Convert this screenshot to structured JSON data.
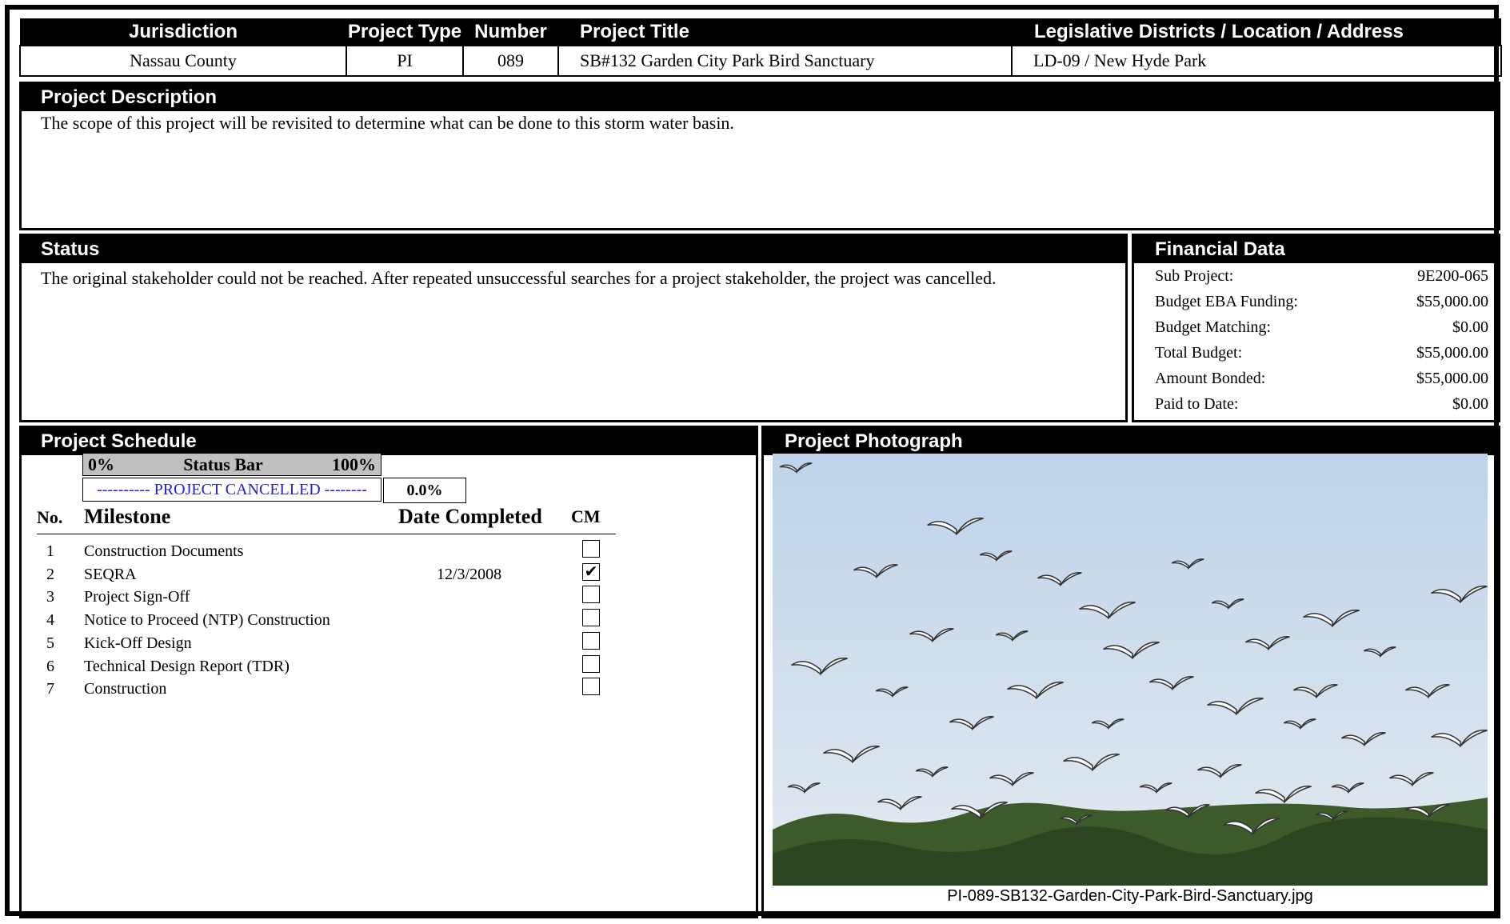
{
  "header": {
    "columns": [
      "Jurisdiction",
      "Project Type",
      "Number",
      "Project Title",
      "Legislative Districts / Location / Address"
    ],
    "values": [
      "Nassau County",
      "PI",
      "089",
      "SB#132 Garden City Park Bird Sanctuary",
      "LD-09 / New Hyde Park"
    ]
  },
  "description": {
    "heading": "Project Description",
    "text": "The scope of this project will be revisited to determine what can be done to this storm water basin."
  },
  "status": {
    "heading": "Status",
    "text": "The original stakeholder could not be reached. After repeated unsuccessful searches for a project stakeholder, the project was cancelled."
  },
  "financial": {
    "heading": "Financial Data",
    "rows": [
      {
        "label": "Sub Project:",
        "value": "9E200-065"
      },
      {
        "label": "Budget EBA Funding:",
        "value": "$55,000.00"
      },
      {
        "label": "Budget Matching:",
        "value": "$0.00"
      },
      {
        "label": "Total Budget:",
        "value": "$55,000.00"
      },
      {
        "label": "Amount Bonded:",
        "value": "$55,000.00"
      },
      {
        "label": "Paid to Date:",
        "value": "$0.00"
      }
    ]
  },
  "schedule": {
    "heading": "Project Schedule",
    "statusbar": {
      "left": "0%",
      "center": "Status Bar",
      "right": "100%",
      "progress_label": "---------- PROJECT CANCELLED --------",
      "percent": "0.0%",
      "progress_fraction": 0.0
    },
    "columns": {
      "no": "No.",
      "milestone": "Milestone",
      "date": "Date Completed",
      "cm": "CM"
    },
    "milestones": [
      {
        "no": "1",
        "name": "Construction Documents",
        "date": "",
        "checked": false
      },
      {
        "no": "2",
        "name": "SEQRA",
        "date": "12/3/2008",
        "checked": true
      },
      {
        "no": "3",
        "name": "Project Sign-Off",
        "date": "",
        "checked": false
      },
      {
        "no": "4",
        "name": "Notice to Proceed (NTP) Construction",
        "date": "",
        "checked": false
      },
      {
        "no": "5",
        "name": "Kick-Off Design",
        "date": "",
        "checked": false
      },
      {
        "no": "6",
        "name": "Technical Design Report (TDR)",
        "date": "",
        "checked": false
      },
      {
        "no": "7",
        "name": "Construction",
        "date": "",
        "checked": false
      }
    ]
  },
  "photo": {
    "heading": "Project Photograph",
    "caption": "PI-089-SB132-Garden-City-Park-Bird-Sanctuary.jpg"
  },
  "check_glyph": "✔"
}
